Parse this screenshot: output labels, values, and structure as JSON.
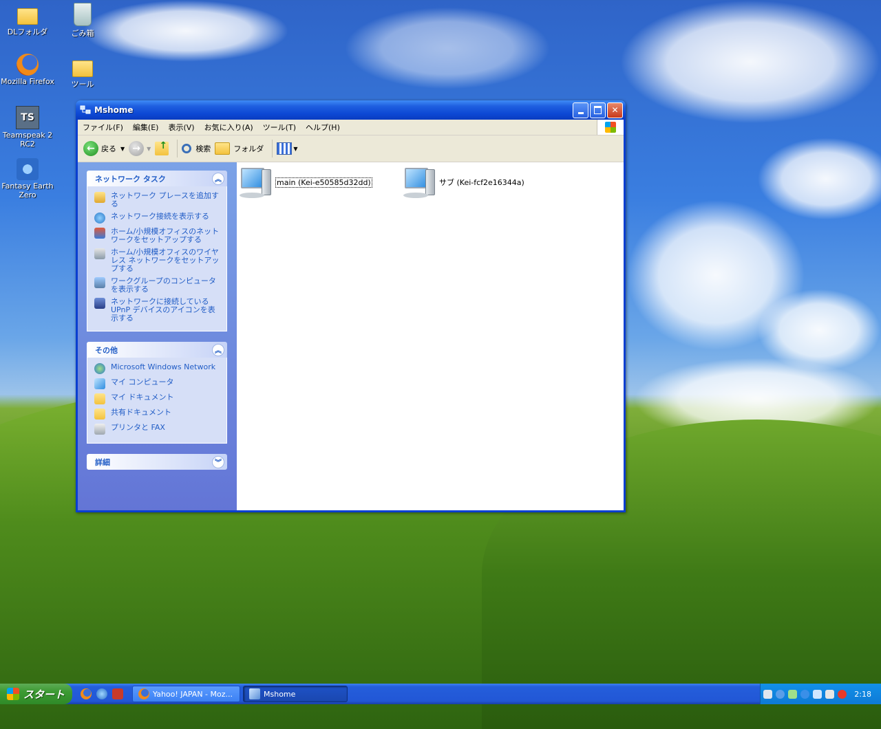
{
  "desktop": {
    "icons": [
      {
        "label": "DLフォルダ"
      },
      {
        "label": "ごみ箱"
      },
      {
        "label": "Mozilla Firefox"
      },
      {
        "label": "ツール"
      },
      {
        "label": "Teamspeak 2 RC2"
      },
      {
        "label": "Fantasy Earth Zero"
      }
    ]
  },
  "window": {
    "title": "Mshome",
    "menu": [
      "ファイル(F)",
      "編集(E)",
      "表示(V)",
      "お気に入り(A)",
      "ツール(T)",
      "ヘルプ(H)"
    ],
    "toolbar": {
      "back_label": "戻る",
      "search_label": "検索",
      "folders_label": "フォルダ"
    },
    "taskpane": {
      "network_tasks": {
        "header": "ネットワーク タスク",
        "links": [
          "ネットワーク プレースを追加する",
          "ネットワーク接続を表示する",
          "ホーム/小規模オフィスのネットワークをセットアップする",
          "ホーム/小規模オフィスのワイヤレス ネットワークをセットアップする",
          "ワークグループのコンピュータを表示する",
          "ネットワークに接続している UPnP デバイスのアイコンを表示する"
        ]
      },
      "other": {
        "header": "その他",
        "links": [
          "Microsoft Windows Network",
          "マイ コンピュータ",
          "マイ ドキュメント",
          "共有ドキュメント",
          "プリンタと FAX"
        ]
      },
      "details": {
        "header": "詳細"
      }
    },
    "items": [
      {
        "label": "main (Kei-e50585d32dd)"
      },
      {
        "label": "サブ (Kei-fcf2e16344a)"
      }
    ]
  },
  "taskbar": {
    "start_label": "スタート",
    "tasks": [
      {
        "label": "Yahoo! JAPAN - Moz..."
      },
      {
        "label": "Mshome"
      }
    ],
    "clock": "2:18"
  }
}
